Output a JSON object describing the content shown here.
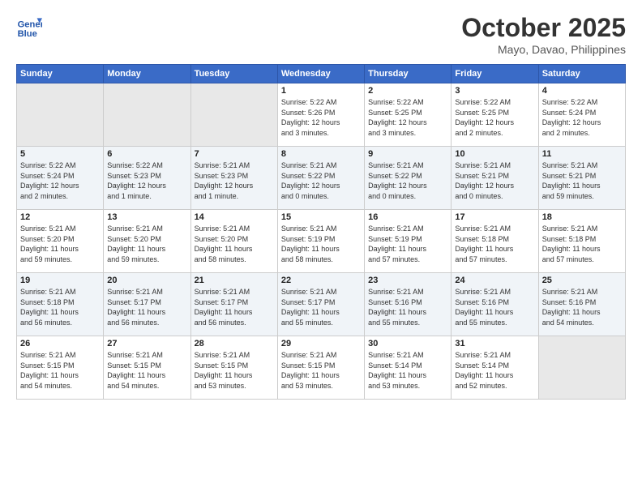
{
  "header": {
    "logo_line1": "General",
    "logo_line2": "Blue",
    "month": "October 2025",
    "location": "Mayo, Davao, Philippines"
  },
  "weekdays": [
    "Sunday",
    "Monday",
    "Tuesday",
    "Wednesday",
    "Thursday",
    "Friday",
    "Saturday"
  ],
  "weeks": [
    [
      {
        "day": "",
        "info": ""
      },
      {
        "day": "",
        "info": ""
      },
      {
        "day": "",
        "info": ""
      },
      {
        "day": "1",
        "info": "Sunrise: 5:22 AM\nSunset: 5:26 PM\nDaylight: 12 hours\nand 3 minutes."
      },
      {
        "day": "2",
        "info": "Sunrise: 5:22 AM\nSunset: 5:25 PM\nDaylight: 12 hours\nand 3 minutes."
      },
      {
        "day": "3",
        "info": "Sunrise: 5:22 AM\nSunset: 5:25 PM\nDaylight: 12 hours\nand 2 minutes."
      },
      {
        "day": "4",
        "info": "Sunrise: 5:22 AM\nSunset: 5:24 PM\nDaylight: 12 hours\nand 2 minutes."
      }
    ],
    [
      {
        "day": "5",
        "info": "Sunrise: 5:22 AM\nSunset: 5:24 PM\nDaylight: 12 hours\nand 2 minutes."
      },
      {
        "day": "6",
        "info": "Sunrise: 5:22 AM\nSunset: 5:23 PM\nDaylight: 12 hours\nand 1 minute."
      },
      {
        "day": "7",
        "info": "Sunrise: 5:21 AM\nSunset: 5:23 PM\nDaylight: 12 hours\nand 1 minute."
      },
      {
        "day": "8",
        "info": "Sunrise: 5:21 AM\nSunset: 5:22 PM\nDaylight: 12 hours\nand 0 minutes."
      },
      {
        "day": "9",
        "info": "Sunrise: 5:21 AM\nSunset: 5:22 PM\nDaylight: 12 hours\nand 0 minutes."
      },
      {
        "day": "10",
        "info": "Sunrise: 5:21 AM\nSunset: 5:21 PM\nDaylight: 12 hours\nand 0 minutes."
      },
      {
        "day": "11",
        "info": "Sunrise: 5:21 AM\nSunset: 5:21 PM\nDaylight: 11 hours\nand 59 minutes."
      }
    ],
    [
      {
        "day": "12",
        "info": "Sunrise: 5:21 AM\nSunset: 5:20 PM\nDaylight: 11 hours\nand 59 minutes."
      },
      {
        "day": "13",
        "info": "Sunrise: 5:21 AM\nSunset: 5:20 PM\nDaylight: 11 hours\nand 59 minutes."
      },
      {
        "day": "14",
        "info": "Sunrise: 5:21 AM\nSunset: 5:20 PM\nDaylight: 11 hours\nand 58 minutes."
      },
      {
        "day": "15",
        "info": "Sunrise: 5:21 AM\nSunset: 5:19 PM\nDaylight: 11 hours\nand 58 minutes."
      },
      {
        "day": "16",
        "info": "Sunrise: 5:21 AM\nSunset: 5:19 PM\nDaylight: 11 hours\nand 57 minutes."
      },
      {
        "day": "17",
        "info": "Sunrise: 5:21 AM\nSunset: 5:18 PM\nDaylight: 11 hours\nand 57 minutes."
      },
      {
        "day": "18",
        "info": "Sunrise: 5:21 AM\nSunset: 5:18 PM\nDaylight: 11 hours\nand 57 minutes."
      }
    ],
    [
      {
        "day": "19",
        "info": "Sunrise: 5:21 AM\nSunset: 5:18 PM\nDaylight: 11 hours\nand 56 minutes."
      },
      {
        "day": "20",
        "info": "Sunrise: 5:21 AM\nSunset: 5:17 PM\nDaylight: 11 hours\nand 56 minutes."
      },
      {
        "day": "21",
        "info": "Sunrise: 5:21 AM\nSunset: 5:17 PM\nDaylight: 11 hours\nand 56 minutes."
      },
      {
        "day": "22",
        "info": "Sunrise: 5:21 AM\nSunset: 5:17 PM\nDaylight: 11 hours\nand 55 minutes."
      },
      {
        "day": "23",
        "info": "Sunrise: 5:21 AM\nSunset: 5:16 PM\nDaylight: 11 hours\nand 55 minutes."
      },
      {
        "day": "24",
        "info": "Sunrise: 5:21 AM\nSunset: 5:16 PM\nDaylight: 11 hours\nand 55 minutes."
      },
      {
        "day": "25",
        "info": "Sunrise: 5:21 AM\nSunset: 5:16 PM\nDaylight: 11 hours\nand 54 minutes."
      }
    ],
    [
      {
        "day": "26",
        "info": "Sunrise: 5:21 AM\nSunset: 5:15 PM\nDaylight: 11 hours\nand 54 minutes."
      },
      {
        "day": "27",
        "info": "Sunrise: 5:21 AM\nSunset: 5:15 PM\nDaylight: 11 hours\nand 54 minutes."
      },
      {
        "day": "28",
        "info": "Sunrise: 5:21 AM\nSunset: 5:15 PM\nDaylight: 11 hours\nand 53 minutes."
      },
      {
        "day": "29",
        "info": "Sunrise: 5:21 AM\nSunset: 5:15 PM\nDaylight: 11 hours\nand 53 minutes."
      },
      {
        "day": "30",
        "info": "Sunrise: 5:21 AM\nSunset: 5:14 PM\nDaylight: 11 hours\nand 53 minutes."
      },
      {
        "day": "31",
        "info": "Sunrise: 5:21 AM\nSunset: 5:14 PM\nDaylight: 11 hours\nand 52 minutes."
      },
      {
        "day": "",
        "info": ""
      }
    ]
  ]
}
